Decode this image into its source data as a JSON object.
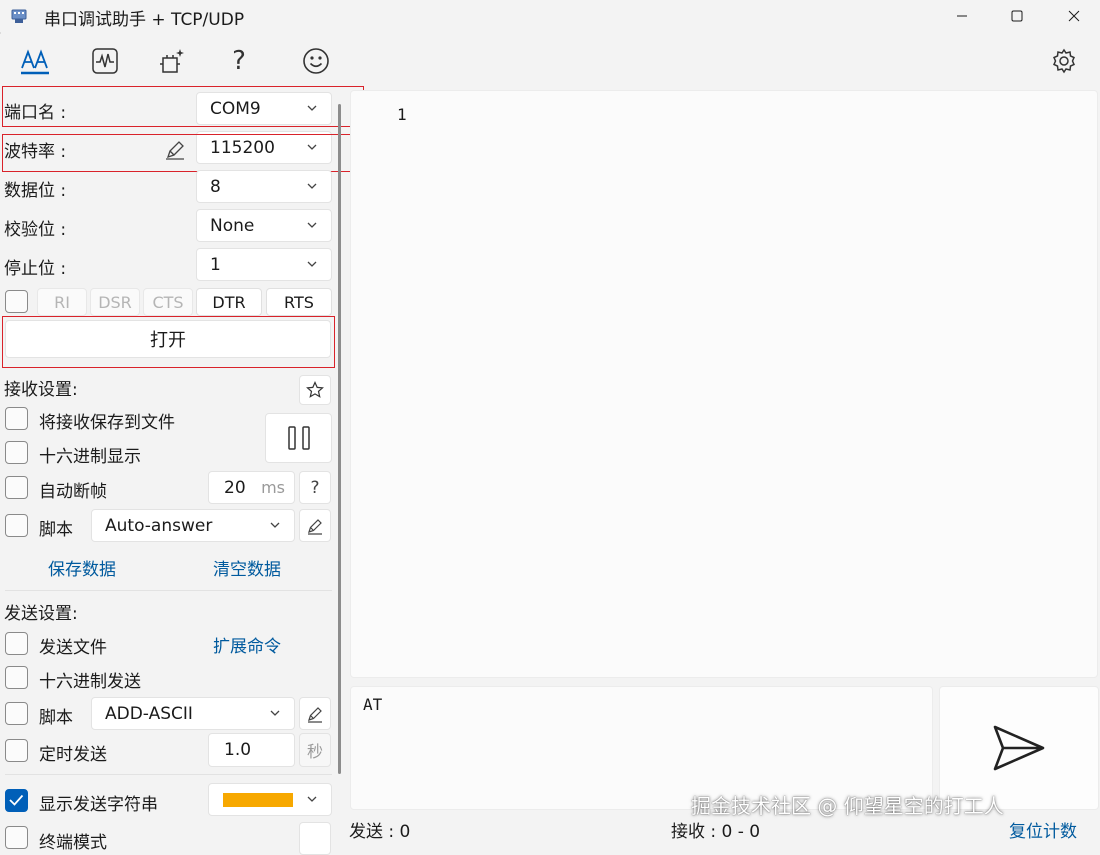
{
  "window": {
    "title": "串口调试助手 + TCP/UDP",
    "app_icon": "serial-port-icon",
    "controls": [
      "minimize-icon",
      "maximize-icon",
      "close-icon"
    ]
  },
  "toolbar": {
    "tools": [
      "text-style-icon",
      "waveform-icon",
      "sparkle-plugin-icon",
      "help-icon",
      "smiley-icon"
    ],
    "help_glyph": "?",
    "settings_icon": "gear-icon"
  },
  "serial": {
    "port_label": "端口名 :",
    "port_value": "COM9",
    "baud_label": "波特率 :",
    "baud_value": "115200",
    "databits_label": "数据位 :",
    "databits_value": "8",
    "parity_label": "校验位 :",
    "parity_value": "None",
    "stopbits_label": "停止位 :",
    "stopbits_value": "1",
    "signals": [
      "RI",
      "DSR",
      "CTS",
      "DTR",
      "RTS"
    ],
    "open_button": "打开"
  },
  "receive": {
    "header": "接收设置:",
    "save_to_file": "将接收保存到文件",
    "hex_display": "十六进制显示",
    "auto_frame": "自动断帧",
    "frame_value": "20",
    "frame_unit": "ms",
    "help": "?",
    "script_label": "脚本",
    "script_value": "Auto-answer",
    "save_data": "保存数据",
    "clear_data": "清空数据",
    "content": "1"
  },
  "send": {
    "header": "发送设置:",
    "send_file": "发送文件",
    "extend_cmd": "扩展命令",
    "hex_send": "十六进制发送",
    "script_label": "脚本",
    "script_value": "ADD-ASCII",
    "timed_send": "定时发送",
    "interval_value": "1.0",
    "interval_unit": "秒",
    "show_string": "显示发送字符串",
    "show_string_checked": true,
    "show_color": "#f7a800",
    "cut_off_label": "终端模式",
    "content": "AT"
  },
  "status": {
    "sent": "发送 : 0",
    "received": "接收 : 0  -  0",
    "reset": "复位计数"
  },
  "watermark": "掘金技术社区 @ 仰望星空的打工人",
  "colors": {
    "accent": "#005fb8",
    "highlight_box": "#d9222a",
    "link": "#005a9e"
  }
}
